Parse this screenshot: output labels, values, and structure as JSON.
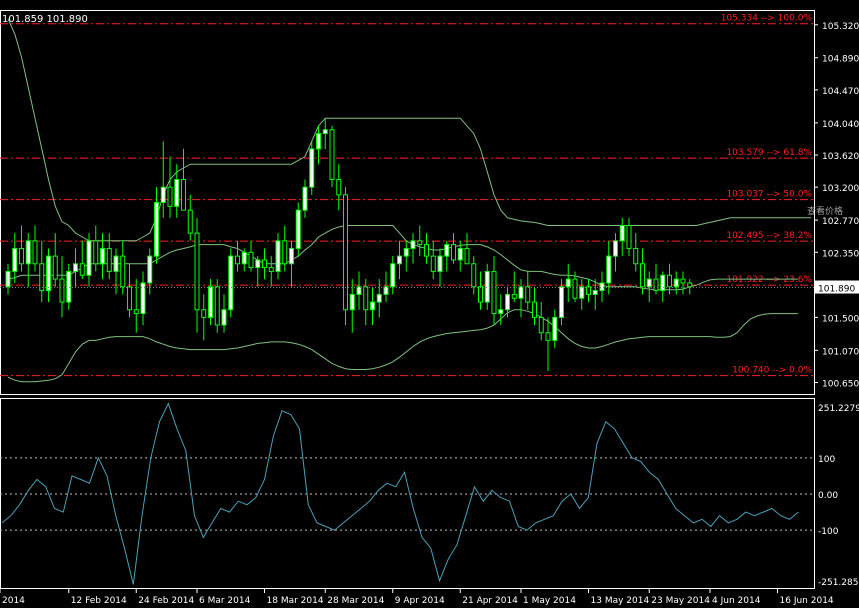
{
  "header": {
    "quote": "101.859 101.890"
  },
  "watermark": "查看价格",
  "colors": {
    "background": "#000000",
    "frame": "#ffffff",
    "bull": "#ffffff",
    "bear": "#00ff00",
    "wick": "#00ff00",
    "bands": "#80c080",
    "fibo": "#ff2020",
    "cci": "#4aa0b8",
    "axis_text": "#ffffff"
  },
  "chart_data": [
    {
      "type": "candlestick",
      "name": "price",
      "ylim": [
        100.5,
        105.5
      ],
      "yticks": [
        "105.320",
        "104.890",
        "104.470",
        "104.040",
        "103.620",
        "103.200",
        "102.770",
        "102.350",
        "101.930",
        "101.500",
        "101.070",
        "100.650"
      ],
      "price_label": "101.890",
      "price_line": 101.89,
      "x_labels": [
        "2014",
        "12 Feb 2014",
        "24 Feb 2014",
        "6 Mar 2014",
        "18 Mar 2014",
        "28 Mar 2014",
        "9 Apr 2014",
        "21 Apr 2014",
        "1 May 2014",
        "13 May 2014",
        "23 May 2014",
        "4 Jun 2014",
        "16 Jun 2014"
      ],
      "x_label_bars": [
        0,
        9,
        19,
        28,
        38,
        47,
        57,
        67,
        76,
        86,
        95,
        104,
        114
      ],
      "fibo_levels": [
        {
          "value": 105.334,
          "label": "105.334 --> 100.0%"
        },
        {
          "value": 103.579,
          "label": "103.579 --> 61.8%"
        },
        {
          "value": 103.037,
          "label": "103.037 --> 50.0%"
        },
        {
          "value": 102.495,
          "label": "102.495 --> 38.2%"
        },
        {
          "value": 101.922,
          "label": "101.922 --> 23.6%"
        },
        {
          "value": 100.74,
          "label": "100.740 --> 0.0%"
        }
      ],
      "bands": {
        "upper": [
          105.4,
          105.2,
          104.9,
          104.5,
          104.1,
          103.7,
          103.3,
          102.95,
          102.75,
          102.7,
          102.6,
          102.55,
          102.5,
          102.5,
          102.5,
          102.5,
          102.5,
          102.5,
          102.5,
          102.5,
          102.55,
          102.6,
          102.8,
          103.1,
          103.3,
          103.4,
          103.45,
          103.5,
          103.5,
          103.5,
          103.5,
          103.5,
          103.5,
          103.5,
          103.5,
          103.5,
          103.5,
          103.5,
          103.5,
          103.5,
          103.5,
          103.5,
          103.5,
          103.55,
          103.6,
          103.8,
          104.0,
          104.1,
          104.1,
          104.1,
          104.1,
          104.1,
          104.1,
          104.1,
          104.1,
          104.1,
          104.1,
          104.1,
          104.1,
          104.1,
          104.1,
          104.1,
          104.1,
          104.1,
          104.1,
          104.1,
          104.1,
          104.1,
          104.0,
          103.9,
          103.7,
          103.4,
          103.1,
          102.9,
          102.8,
          102.78,
          102.76,
          102.75,
          102.74,
          102.72,
          102.7,
          102.7,
          102.7,
          102.7,
          102.7,
          102.7,
          102.7,
          102.7,
          102.7,
          102.7,
          102.7,
          102.7,
          102.7,
          102.7,
          102.7,
          102.7,
          102.7,
          102.7,
          102.7,
          102.7,
          102.7,
          102.7,
          102.7,
          102.72,
          102.74,
          102.76,
          102.78,
          102.8,
          102.8,
          102.8,
          102.8,
          102.8,
          102.8,
          102.8,
          102.8,
          102.8,
          102.8,
          102.8,
          102.8,
          102.8
        ],
        "middle": [
          102.0,
          102.02,
          102.05,
          102.05,
          102.05,
          102.05,
          102.05,
          102.05,
          102.05,
          102.05,
          102.1,
          102.15,
          102.2,
          102.2,
          102.2,
          102.2,
          102.2,
          102.2,
          102.2,
          102.2,
          102.2,
          102.2,
          102.25,
          102.3,
          102.35,
          102.38,
          102.4,
          102.42,
          102.45,
          102.45,
          102.45,
          102.45,
          102.45,
          102.42,
          102.4,
          102.35,
          102.3,
          102.25,
          102.2,
          102.2,
          102.2,
          102.2,
          102.25,
          102.3,
          102.38,
          102.45,
          102.55,
          102.6,
          102.65,
          102.68,
          102.7,
          102.7,
          102.7,
          102.7,
          102.7,
          102.7,
          102.7,
          102.7,
          102.6,
          102.5,
          102.45,
          102.42,
          102.4,
          102.38,
          102.38,
          102.4,
          102.42,
          102.44,
          102.45,
          102.45,
          102.45,
          102.42,
          102.38,
          102.32,
          102.25,
          102.18,
          102.12,
          102.1,
          102.1,
          102.1,
          102.08,
          102.06,
          102.05,
          102.05,
          102.04,
          102.02,
          102.0,
          101.96,
          101.92,
          101.9,
          101.9,
          101.9,
          101.9,
          101.9,
          101.88,
          101.87,
          101.86,
          101.86,
          101.86,
          101.86,
          101.87,
          101.9,
          101.92,
          101.96,
          101.99,
          102.0,
          102.0,
          102.0,
          102.0,
          102.0,
          102.0,
          102.0,
          102.0,
          102.0,
          102.0,
          102.0,
          102.0,
          102.0
        ],
        "lower": [
          100.72,
          100.68,
          100.66,
          100.66,
          100.66,
          100.67,
          100.68,
          100.7,
          100.75,
          100.9,
          101.05,
          101.15,
          101.2,
          101.2,
          101.22,
          101.24,
          101.25,
          101.25,
          101.25,
          101.25,
          101.25,
          101.22,
          101.18,
          101.15,
          101.12,
          101.1,
          101.09,
          101.08,
          101.08,
          101.08,
          101.08,
          101.08,
          101.08,
          101.09,
          101.1,
          101.12,
          101.14,
          101.16,
          101.17,
          101.18,
          101.18,
          101.18,
          101.17,
          101.15,
          101.12,
          101.08,
          101.02,
          100.96,
          100.9,
          100.86,
          100.83,
          100.82,
          100.82,
          100.82,
          100.83,
          100.85,
          100.88,
          100.92,
          100.98,
          101.05,
          101.12,
          101.18,
          101.22,
          101.25,
          101.27,
          101.29,
          101.3,
          101.31,
          101.32,
          101.33,
          101.34,
          101.36,
          101.4,
          101.48,
          101.56,
          101.6,
          101.6,
          101.58,
          101.55,
          101.5,
          101.45,
          101.38,
          101.3,
          101.22,
          101.16,
          101.12,
          101.1,
          101.1,
          101.12,
          101.15,
          101.18,
          101.2,
          101.22,
          101.23,
          101.24,
          101.25,
          101.25,
          101.25,
          101.25,
          101.25,
          101.25,
          101.25,
          101.25,
          101.25,
          101.25,
          101.24,
          101.24,
          101.25,
          101.3,
          101.4,
          101.48,
          101.52,
          101.54,
          101.55,
          101.55,
          101.55,
          101.55,
          101.55
        ],
        "upper_tail": [
          [
            119,
            102.05
          ],
          [
            121,
            102.05
          ]
        ],
        "middle_tail": [
          [
            119,
            101.95
          ],
          [
            121,
            101.95
          ]
        ],
        "lower_tail": [
          [
            119,
            101.55
          ],
          [
            121,
            101.55
          ]
        ]
      },
      "candles": [
        [
          101.9,
          102.2,
          101.8,
          102.1
        ],
        [
          102.1,
          102.6,
          101.95,
          102.4
        ],
        [
          102.4,
          102.7,
          102.1,
          102.2
        ],
        [
          102.2,
          102.6,
          101.9,
          102.5
        ],
        [
          102.5,
          102.7,
          102.1,
          102.2
        ],
        [
          102.2,
          102.5,
          101.7,
          101.85
        ],
        [
          101.85,
          102.4,
          101.7,
          102.3
        ],
        [
          102.3,
          102.6,
          101.9,
          102.0
        ],
        [
          102.0,
          102.3,
          101.5,
          101.7
        ],
        [
          101.7,
          102.2,
          101.6,
          102.1
        ],
        [
          102.1,
          102.4,
          101.9,
          102.2
        ],
        [
          102.2,
          102.5,
          102.0,
          102.05
        ],
        [
          102.05,
          102.6,
          101.9,
          102.5
        ],
        [
          102.5,
          102.7,
          102.1,
          102.2
        ],
        [
          102.2,
          102.6,
          102.0,
          102.4
        ],
        [
          102.4,
          102.6,
          102.0,
          102.1
        ],
        [
          102.1,
          102.4,
          101.8,
          102.3
        ],
        [
          102.3,
          102.5,
          101.8,
          101.9
        ],
        [
          101.9,
          102.2,
          101.5,
          101.6
        ],
        [
          101.6,
          102.0,
          101.3,
          101.55
        ],
        [
          101.55,
          102.1,
          101.4,
          101.95
        ],
        [
          101.95,
          102.4,
          101.8,
          102.3
        ],
        [
          102.3,
          103.2,
          102.2,
          103.0
        ],
        [
          103.0,
          103.8,
          102.8,
          103.2
        ],
        [
          103.2,
          103.6,
          102.8,
          102.95
        ],
        [
          102.95,
          103.5,
          102.8,
          103.3
        ],
        [
          103.3,
          103.7,
          103.0,
          102.9
        ],
        [
          102.9,
          103.1,
          102.5,
          102.6
        ],
        [
          102.6,
          102.8,
          101.3,
          101.6
        ],
        [
          101.6,
          101.8,
          101.2,
          101.5
        ],
        [
          101.5,
          102.0,
          101.4,
          101.9
        ],
        [
          101.9,
          102.0,
          101.3,
          101.4
        ],
        [
          101.4,
          101.8,
          101.3,
          101.6
        ],
        [
          101.6,
          102.4,
          101.5,
          102.3
        ],
        [
          102.3,
          102.5,
          102.1,
          102.2
        ],
        [
          102.2,
          102.4,
          102.1,
          102.35
        ],
        [
          102.35,
          102.5,
          102.1,
          102.15
        ],
        [
          102.15,
          102.3,
          101.9,
          102.25
        ],
        [
          102.25,
          102.4,
          102.0,
          102.15
        ],
        [
          102.15,
          102.3,
          101.9,
          102.1
        ],
        [
          102.1,
          102.6,
          102.0,
          102.5
        ],
        [
          102.5,
          102.7,
          102.1,
          102.2
        ],
        [
          102.2,
          102.5,
          101.9,
          102.4
        ],
        [
          102.4,
          103.0,
          102.3,
          102.9
        ],
        [
          102.9,
          103.3,
          102.8,
          103.2
        ],
        [
          103.2,
          103.8,
          103.1,
          103.7
        ],
        [
          103.7,
          104.0,
          103.5,
          103.9
        ],
        [
          103.9,
          104.1,
          103.7,
          103.95
        ],
        [
          103.95,
          104.0,
          103.2,
          103.3
        ],
        [
          103.3,
          103.5,
          102.9,
          103.1
        ],
        [
          103.1,
          103.2,
          101.4,
          101.6
        ],
        [
          101.6,
          102.0,
          101.3,
          101.8
        ],
        [
          101.8,
          102.1,
          101.6,
          101.9
        ],
        [
          101.9,
          102.0,
          101.4,
          101.6
        ],
        [
          101.6,
          101.9,
          101.4,
          101.7
        ],
        [
          101.7,
          102.0,
          101.5,
          101.8
        ],
        [
          101.8,
          102.1,
          101.7,
          101.9
        ],
        [
          101.9,
          102.3,
          101.8,
          102.2
        ],
        [
          102.2,
          102.5,
          102.0,
          102.3
        ],
        [
          102.3,
          102.5,
          102.1,
          102.4
        ],
        [
          102.4,
          102.6,
          102.2,
          102.5
        ],
        [
          102.5,
          102.7,
          102.3,
          102.45
        ],
        [
          102.45,
          102.6,
          102.2,
          102.3
        ],
        [
          102.3,
          102.5,
          102.0,
          102.1
        ],
        [
          102.1,
          102.4,
          101.9,
          102.3
        ],
        [
          102.3,
          102.5,
          102.1,
          102.45
        ],
        [
          102.45,
          102.6,
          102.2,
          102.25
        ],
        [
          102.25,
          102.5,
          102.1,
          102.4
        ],
        [
          102.4,
          102.6,
          102.2,
          102.2
        ],
        [
          102.2,
          102.3,
          101.8,
          101.9
        ],
        [
          101.9,
          102.1,
          101.6,
          101.7
        ],
        [
          101.7,
          102.2,
          101.6,
          102.1
        ],
        [
          102.1,
          102.3,
          101.4,
          101.55
        ],
        [
          101.55,
          101.8,
          101.4,
          101.6
        ],
        [
          101.6,
          101.9,
          101.5,
          101.8
        ],
        [
          101.8,
          102.1,
          101.7,
          101.75
        ],
        [
          101.75,
          102.0,
          101.5,
          101.9
        ],
        [
          101.9,
          102.1,
          101.6,
          101.7
        ],
        [
          101.7,
          101.9,
          101.4,
          101.5
        ],
        [
          101.5,
          101.7,
          101.2,
          101.3
        ],
        [
          101.3,
          101.5,
          100.8,
          101.2
        ],
        [
          101.2,
          101.6,
          101.1,
          101.5
        ],
        [
          101.5,
          102.0,
          101.4,
          101.9
        ],
        [
          101.9,
          102.2,
          101.7,
          102.0
        ],
        [
          102.0,
          102.1,
          101.7,
          101.75
        ],
        [
          101.75,
          102.0,
          101.6,
          101.9
        ],
        [
          101.9,
          102.0,
          101.7,
          101.8
        ],
        [
          101.8,
          102.0,
          101.6,
          101.85
        ],
        [
          101.85,
          102.1,
          101.7,
          101.95
        ],
        [
          101.95,
          102.5,
          101.8,
          102.3
        ],
        [
          102.3,
          102.6,
          102.1,
          102.5
        ],
        [
          102.5,
          102.8,
          102.3,
          102.7
        ],
        [
          102.7,
          102.8,
          102.3,
          102.4
        ],
        [
          102.4,
          102.6,
          102.1,
          102.2
        ],
        [
          102.2,
          102.4,
          101.8,
          101.9
        ],
        [
          101.9,
          102.1,
          101.7,
          102.0
        ],
        [
          102.0,
          102.2,
          101.8,
          101.85
        ],
        [
          101.85,
          102.1,
          101.7,
          102.05
        ],
        [
          102.05,
          102.2,
          101.8,
          101.9
        ],
        [
          101.9,
          102.1,
          101.8,
          102.0
        ],
        [
          102.0,
          102.1,
          101.8,
          101.95
        ],
        [
          101.95,
          102.0,
          101.8,
          101.9
        ]
      ],
      "candle_x0": 8,
      "candle_step": 6.75
    },
    {
      "type": "line",
      "name": "cci",
      "ylim": [
        -260,
        260
      ],
      "yticks": [
        "251.2279",
        "100",
        "0.00",
        "-100",
        "-251.2858"
      ],
      "levels": [
        100,
        0,
        -100
      ],
      "values": [
        -80,
        -60,
        -30,
        10,
        40,
        20,
        -40,
        -50,
        50,
        40,
        30,
        100,
        50,
        -60,
        -150,
        -250,
        -60,
        100,
        200,
        250,
        180,
        120,
        -60,
        -120,
        -80,
        -40,
        -50,
        -20,
        -30,
        -10,
        40,
        160,
        230,
        220,
        180,
        -30,
        -80,
        -90,
        -100,
        -80,
        -60,
        -40,
        -20,
        10,
        30,
        20,
        60,
        -40,
        -120,
        -150,
        -240,
        -180,
        -140,
        -60,
        20,
        -20,
        10,
        -10,
        -20,
        -90,
        -100,
        -80,
        -70,
        -60,
        -20,
        0,
        -40,
        -10,
        140,
        200,
        180,
        140,
        100,
        90,
        60,
        40,
        0,
        -40,
        -60,
        -80,
        -70,
        -90,
        -60,
        -80,
        -70,
        -50,
        -60,
        -50,
        -40,
        -60,
        -70,
        -50
      ],
      "x0": 2,
      "x_step": 8.75
    }
  ]
}
